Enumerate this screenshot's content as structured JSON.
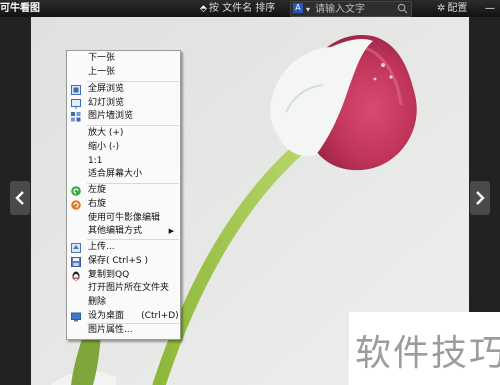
{
  "header": {
    "app_title": "可牛看图",
    "sort_label": "按 文件名 排序",
    "search_placeholder": "请输入文字",
    "config_label": "配置"
  },
  "menu": {
    "items": [
      {
        "label": "下一张"
      },
      {
        "label": "上一张"
      },
      {
        "label": "全屏浏览",
        "icon": "fullscreen-icon"
      },
      {
        "label": "幻灯浏览",
        "icon": "slideshow-icon"
      },
      {
        "label": "图片墙浏览",
        "icon": "photo-wall-icon"
      },
      {
        "label": "放大 (+)"
      },
      {
        "label": "缩小 (-)"
      },
      {
        "label": "1:1"
      },
      {
        "label": "适合屏幕大小"
      },
      {
        "label": "左旋",
        "icon": "rotate-left-icon"
      },
      {
        "label": "右旋",
        "icon": "rotate-right-icon"
      },
      {
        "label": "使用可牛影像编辑"
      },
      {
        "label": "其他编辑方式",
        "has_submenu": true
      },
      {
        "label": "上传...",
        "icon": "upload-icon"
      },
      {
        "label": "保存( Ctrl+S )",
        "icon": "save-icon"
      },
      {
        "label": "复制到QQ",
        "icon": "qq-icon"
      },
      {
        "label": "打开图片所在文件夹"
      },
      {
        "label": "删除"
      },
      {
        "label": "设为桌面      (Ctrl+D)",
        "icon": "desktop-icon"
      },
      {
        "label": "图片属性..."
      }
    ]
  },
  "watermark": {
    "text": "软件技巧"
  },
  "colors": {
    "menu_bg": "#fafafa",
    "topbar_bg": "#1a1a1a",
    "accent": "#2b55b8"
  }
}
